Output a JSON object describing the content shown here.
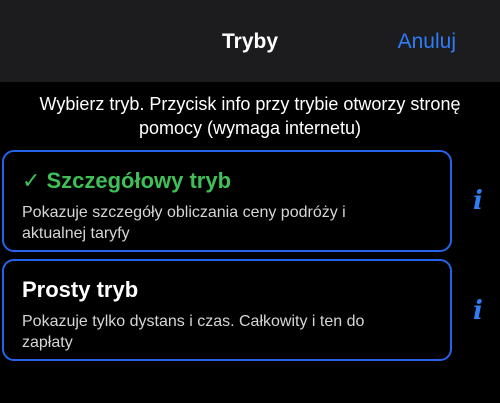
{
  "navbar": {
    "title": "Tryby",
    "cancel_label": "Anuluj"
  },
  "instruction": "Wybierz tryb. Przycisk info przy trybie otworzy stronę pomocy (wymaga internetu)",
  "modes": [
    {
      "check": "✓",
      "title": "Szczegółowy tryb",
      "description": "Pokazuje szczegóły obliczania ceny podróży i aktualnej taryfy",
      "selected": true,
      "info_label": "i"
    },
    {
      "title": "Prosty tryb",
      "description": "Pokazuje tylko dystans i czas. Całkowity i ten do zapłaty",
      "selected": false,
      "info_label": "i"
    }
  ],
  "colors": {
    "accent": "#2f7cf6",
    "border": "#2563eb",
    "selected": "#3fbf55",
    "navbar_bg": "#1c1c1e",
    "background": "#000000"
  }
}
